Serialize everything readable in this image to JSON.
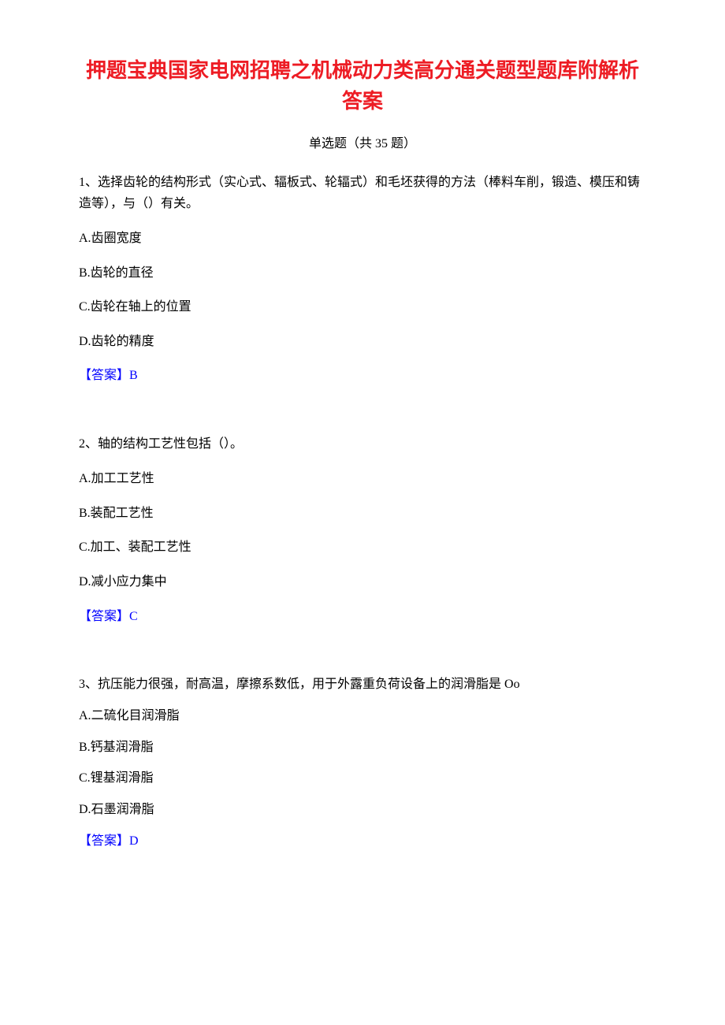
{
  "title": "押题宝典国家电网招聘之机械动力类高分通关题型题库附解析答案",
  "subtitle": "单选题（共 35 题）",
  "questions": [
    {
      "number": "1、",
      "text": "选择齿轮的结构形式（实心式、辐板式、轮辐式）和毛坯获得的方法（棒料车削，锻造、模压和铸造等），与（）有关。",
      "options": [
        {
          "label": "A.",
          "text": "齿圈宽度"
        },
        {
          "label": "B.",
          "text": "齿轮的直径"
        },
        {
          "label": "C.",
          "text": "齿轮在轴上的位置"
        },
        {
          "label": "D.",
          "text": "齿轮的精度"
        }
      ],
      "answer_prefix": "【答案】",
      "answer_letter": "B"
    },
    {
      "number": "2、",
      "text": "轴的结构工艺性包括（）。",
      "options": [
        {
          "label": "A.",
          "text": "加工工艺性"
        },
        {
          "label": "B.",
          "text": "装配工艺性"
        },
        {
          "label": "C.",
          "text": "加工、装配工艺性"
        },
        {
          "label": "D.",
          "text": "减小应力集中"
        }
      ],
      "answer_prefix": "【答案】",
      "answer_letter": "C"
    },
    {
      "number": "3、",
      "text": "抗压能力很强，耐高温，摩擦系数低，用于外露重负荷设备上的润滑脂是 Oo",
      "options": [
        {
          "label": "A.",
          "text": "二硫化目润滑脂"
        },
        {
          "label": "B.",
          "text": "钙基润滑脂"
        },
        {
          "label": "C.",
          "text": "锂基润滑脂"
        },
        {
          "label": "D.",
          "text": "石墨润滑脂"
        }
      ],
      "answer_prefix": "【答案】",
      "answer_letter": "D"
    }
  ]
}
